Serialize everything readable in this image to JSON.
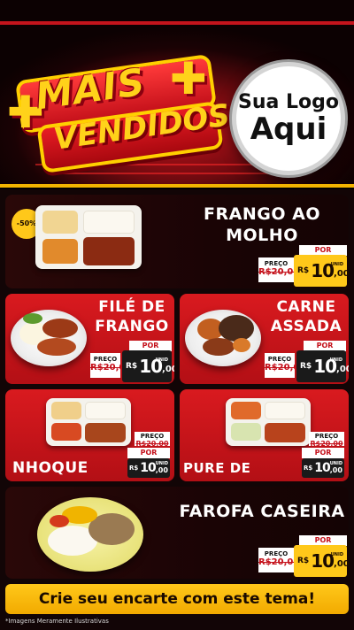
{
  "header": {
    "mais": "MAIS",
    "vendidos": "VENDIDOS",
    "logo_line1": "Sua Logo",
    "logo_line2": "Aqui"
  },
  "items": [
    {
      "name": "FRANGO AO MOLHO",
      "name_line1": "FRANGO AO",
      "name_line2": "MOLHO",
      "badge": "-50%",
      "preco_label": "PREÇO",
      "old_price": "R$20,00",
      "por_label": "POR",
      "currency": "R$",
      "price_int": "10",
      "price_cents": ",00",
      "unit": "UNID"
    },
    {
      "name_line1": "FILÉ DE",
      "name_line2": "FRANGO",
      "preco_label": "PREÇO",
      "old_price": "R$20,00",
      "por_label": "POR",
      "currency": "R$",
      "price_int": "10",
      "price_cents": ",00",
      "unit": "UNID"
    },
    {
      "name_line1": "CARNE",
      "name_line2": "ASSADA",
      "preco_label": "PREÇO",
      "old_price": "R$20,00",
      "por_label": "POR",
      "currency": "R$",
      "price_int": "10",
      "price_cents": ",00",
      "unit": "UNID"
    },
    {
      "name": "NHOQUE",
      "preco_label": "PREÇO",
      "old_price": "R$20,00",
      "por_label": "POR",
      "currency": "R$",
      "price_int": "10",
      "price_cents": ",00",
      "unit": "UNID"
    },
    {
      "name": "PURE DE BATATA",
      "preco_label": "PREÇO",
      "old_price": "R$20,00",
      "por_label": "POR",
      "currency": "R$",
      "price_int": "10",
      "price_cents": ",00",
      "unit": "UNID"
    },
    {
      "name": "FAROFA CASEIRA",
      "preco_label": "PREÇO",
      "old_price": "R$20,00",
      "por_label": "POR",
      "currency": "R$",
      "price_int": "10",
      "price_cents": ",00",
      "unit": "UNID"
    }
  ],
  "footer": {
    "cta": "Crie seu encarte com este tema!",
    "disclaimer": "*Imagens Meramente Ilustrativas"
  },
  "colors": {
    "brand_red": "#d91a1f",
    "accent_yellow": "#ffc81a",
    "dark_panel": "#1a0405"
  }
}
